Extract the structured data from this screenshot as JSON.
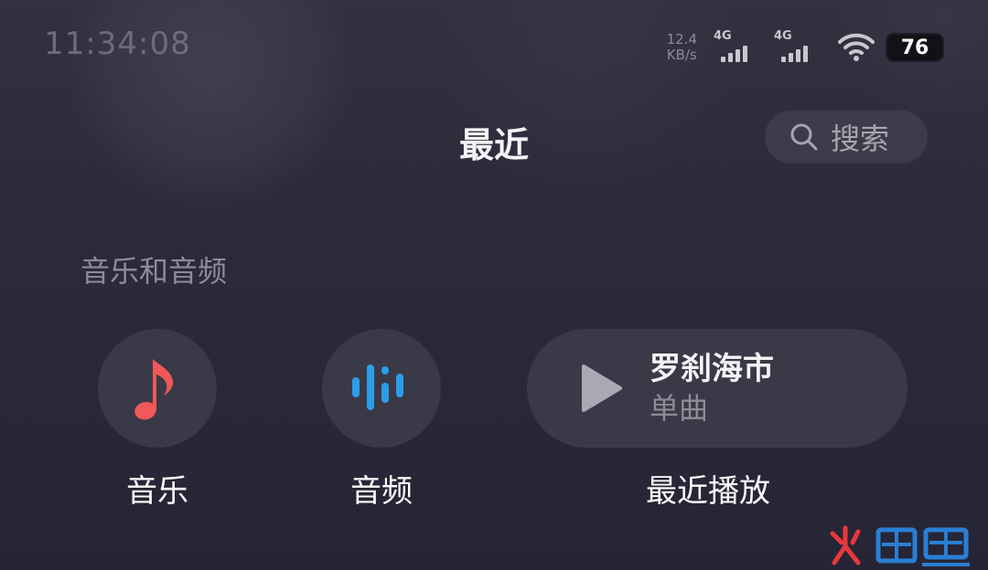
{
  "status_bar": {
    "time": "11:34:08",
    "net_speed_value": "12.4",
    "net_speed_unit": "KB/s",
    "sim1_label": "4G",
    "sim2_label": "4G",
    "battery_level": "76"
  },
  "header": {
    "title": "最近",
    "search_label": "搜索"
  },
  "section": {
    "title": "音乐和音频"
  },
  "entries": {
    "music_label": "音乐",
    "audio_label": "音频"
  },
  "recent": {
    "track_title": "罗刹海市",
    "track_type": "单曲",
    "label": "最近播放"
  },
  "colors": {
    "music_icon": "#f0585a",
    "audio_icon": "#2a9fe8",
    "watermark_red": "#e8383d",
    "watermark_blue": "#2a7fd4"
  }
}
